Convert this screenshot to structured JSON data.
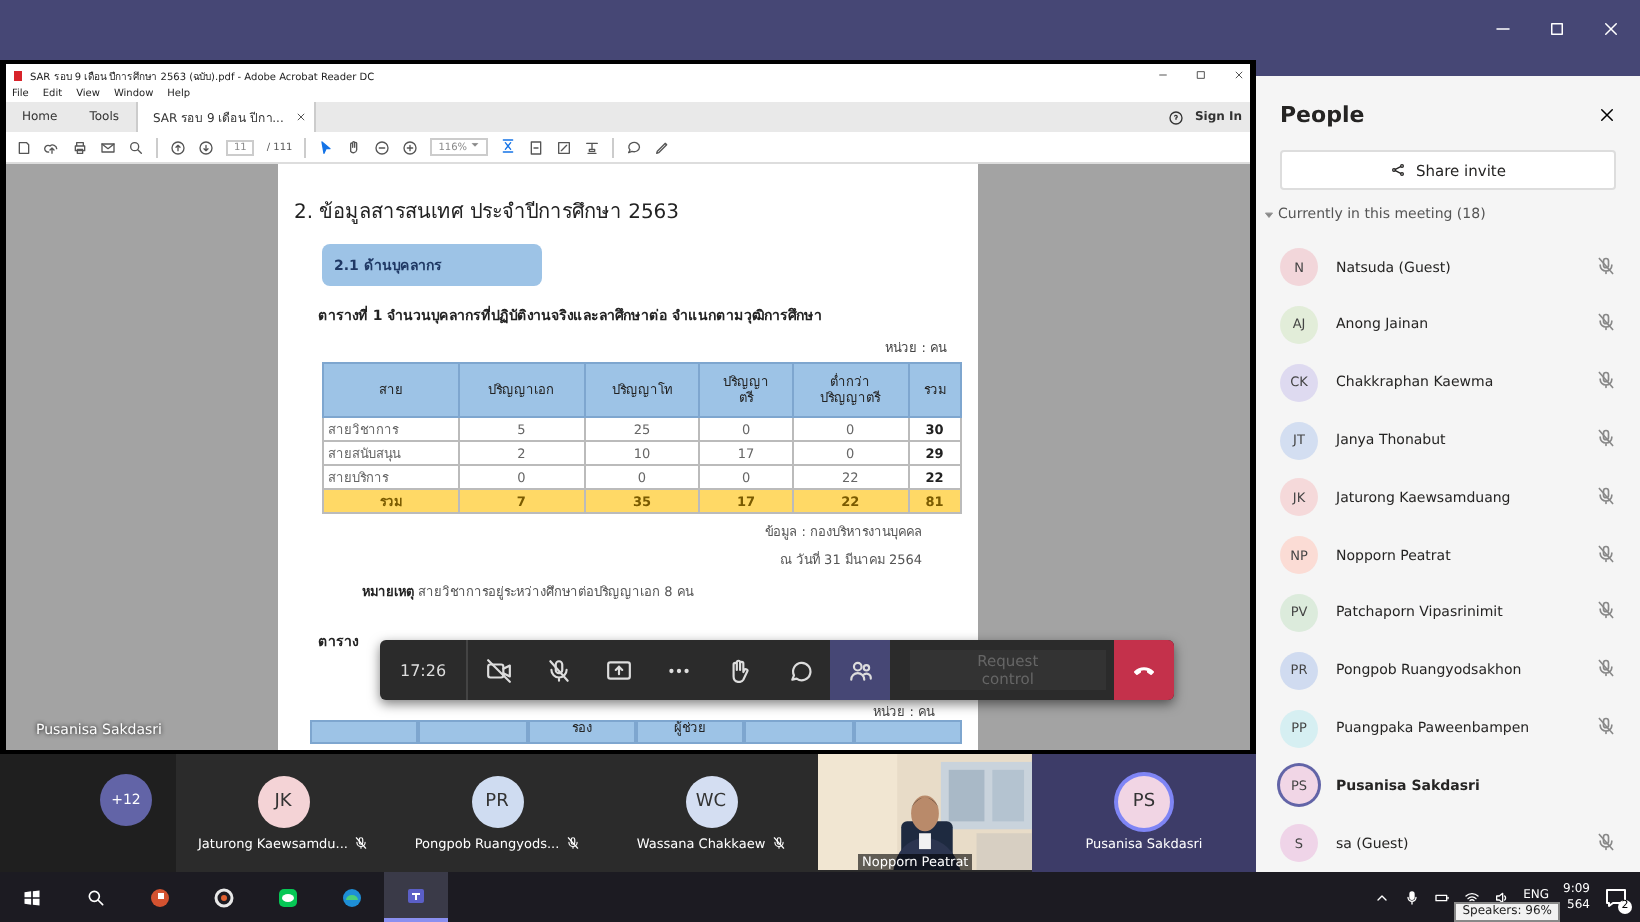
{
  "acrobat": {
    "title": "SAR รอบ 9 เดือน ปีการศึกษา 2563 (ฉบับ).pdf - Adobe Acrobat Reader DC",
    "menu": [
      "File",
      "Edit",
      "View",
      "Window",
      "Help"
    ],
    "tabs": [
      {
        "label": "Home",
        "selected": false
      },
      {
        "label": "Tools",
        "selected": false
      },
      {
        "label": "SAR รอบ 9 เดือน ปีกา...",
        "selected": true
      }
    ],
    "sign_in": "Sign In",
    "page_number": "11",
    "page_count": "/ 111",
    "zoom": "116%"
  },
  "document": {
    "heading": "2. ข้อมูลสารสนเทศ ประจำปีการศึกษา 2563",
    "section": "2.1 ด้านบุคลากร",
    "caption": "ตารางที่ 1 จำนวนบุคลากรที่ปฏิบัติงานจริงและลาศึกษาต่อ จำแนกตามวุฒิการศึกษา",
    "unit": "หน่วย : คน",
    "table": {
      "columns": [
        "สาย",
        "ปริญญาเอก",
        "ปริญญาโท",
        "ปริญญา\nตรี",
        "ต่ำกว่า\nปริญญาตรี",
        "รวม"
      ],
      "rows": [
        [
          "สายวิชาการ",
          "5",
          "25",
          "0",
          "0",
          "30"
        ],
        [
          "สายสนับสนุน",
          "2",
          "10",
          "17",
          "0",
          "29"
        ],
        [
          "สายบริการ",
          "0",
          "0",
          "0",
          "22",
          "22"
        ]
      ],
      "total": [
        "รวม",
        "7",
        "35",
        "17",
        "22",
        "81"
      ]
    },
    "source": [
      "ข้อมูล : กองบริหารงานบุคคล",
      "ณ วันที่ 31 มีนาคม 2564"
    ],
    "note": "**หมายเหตุ** สายวิชาการอยู่ระหว่างศึกษาต่อปริญญาเอก 8 คน",
    "caption_2": "ตาราง",
    "unit_2": "หน่วย : คน",
    "table_2_columns": [
      "",
      "",
      "รอง",
      "ผู้ช่วย",
      "",
      ""
    ]
  },
  "presenter_label": "Pusanisa Sakdasri",
  "call_controls": {
    "timer": "17:26",
    "request_control": "Request control",
    "buttons": [
      {
        "kind": "camera",
        "selected": false
      },
      {
        "kind": "mic",
        "selected": false
      },
      {
        "kind": "share",
        "selected": false
      },
      {
        "kind": "more",
        "selected": false
      },
      {
        "kind": "hand",
        "selected": false
      },
      {
        "kind": "chat",
        "selected": false
      },
      {
        "kind": "people",
        "selected": true
      }
    ]
  },
  "tiles": [
    {
      "kind": "overflow",
      "label": "+12"
    },
    {
      "kind": "avatar",
      "initials": "JK",
      "name": "Jaturong Kaewsamdu...",
      "color": "#f4d3d6",
      "muted": true
    },
    {
      "kind": "avatar",
      "initials": "PR",
      "name": "Pongpob Ruangyods...",
      "color": "#cfdcf1",
      "muted": true
    },
    {
      "kind": "avatar",
      "initials": "WC",
      "name": "Wassana Chakkaew",
      "color": "#d4def2",
      "muted": true
    },
    {
      "kind": "video",
      "name": "Nopporn Peatrat",
      "muted": false
    },
    {
      "kind": "self",
      "initials": "PS",
      "name": "Pusanisa Sakdasri",
      "color": "#f1d5e4",
      "muted": false
    }
  ],
  "people": {
    "title": "People",
    "share_invite": "Share invite",
    "section": "Currently in this meeting (18)",
    "expanded": true,
    "members": [
      {
        "initials": "N",
        "name": "Natsuda (Guest)",
        "color": "#f2d6da",
        "muted": true,
        "speaking": false
      },
      {
        "initials": "AJ",
        "name": "Anong Jainan",
        "color": "#e2edd9",
        "muted": true,
        "speaking": false
      },
      {
        "initials": "CK",
        "name": "Chakkraphan Kaewma",
        "color": "#dedaf0",
        "muted": true,
        "speaking": false
      },
      {
        "initials": "JT",
        "name": "Janya Thonabut",
        "color": "#d3def1",
        "muted": true,
        "speaking": false
      },
      {
        "initials": "JK",
        "name": "Jaturong Kaewsamduang",
        "color": "#f5d9da",
        "muted": true,
        "speaking": false
      },
      {
        "initials": "NP",
        "name": "Nopporn Peatrat",
        "color": "#fbdcd5",
        "muted": true,
        "speaking": false
      },
      {
        "initials": "PV",
        "name": "Patchaporn Vipasrinimit",
        "color": "#dcebdc",
        "muted": true,
        "speaking": false
      },
      {
        "initials": "PR",
        "name": "Pongpob Ruangyodsakhon",
        "color": "#d0dbf0",
        "muted": true,
        "speaking": false
      },
      {
        "initials": "PP",
        "name": "Puangpaka Paweenbampen",
        "color": "#d6eff2",
        "muted": true,
        "speaking": false
      },
      {
        "initials": "PS",
        "name": "Pusanisa Sakdasri",
        "color": "#f1d6e6",
        "muted": false,
        "speaking": true
      },
      {
        "initials": "S",
        "name": "sa (Guest)",
        "color": "#efd4e8",
        "muted": true,
        "speaking": false
      }
    ]
  },
  "taskbar": {
    "language": "ENG",
    "time": "9:09",
    "date": "564",
    "tooltip": "Speakers: 96%",
    "notifications": "2"
  }
}
